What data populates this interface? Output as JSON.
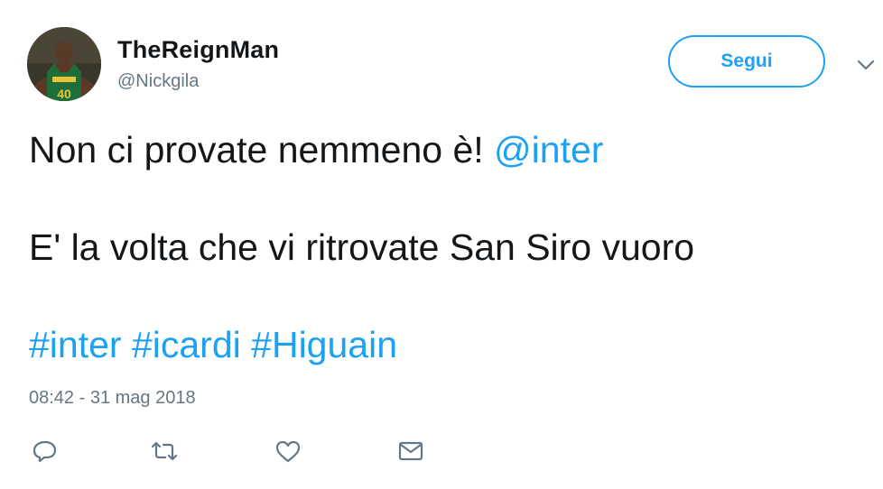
{
  "user": {
    "name": "TheReignMan",
    "handle": "@Nickgila",
    "avatar_icon": "basketball-player-avatar",
    "jersey_number": "40"
  },
  "follow_button": {
    "label": "Segui"
  },
  "tweet": {
    "line1_text": "Non ci provate nemmeno è! ",
    "line1_mention": "@inter",
    "line2_text": "E' la volta che vi ritrovate San Siro vuoro",
    "hashtags": [
      "#inter",
      "#icardi",
      "#Higuain"
    ],
    "timestamp": "08:42 - 31 mag 2018"
  },
  "actions": [
    {
      "name": "reply",
      "icon": "reply-icon"
    },
    {
      "name": "retweet",
      "icon": "retweet-icon"
    },
    {
      "name": "like",
      "icon": "heart-icon"
    },
    {
      "name": "direct-message",
      "icon": "envelope-icon"
    }
  ],
  "colors": {
    "link": "#1da1f2",
    "text": "#14171a",
    "secondary": "#657786"
  }
}
